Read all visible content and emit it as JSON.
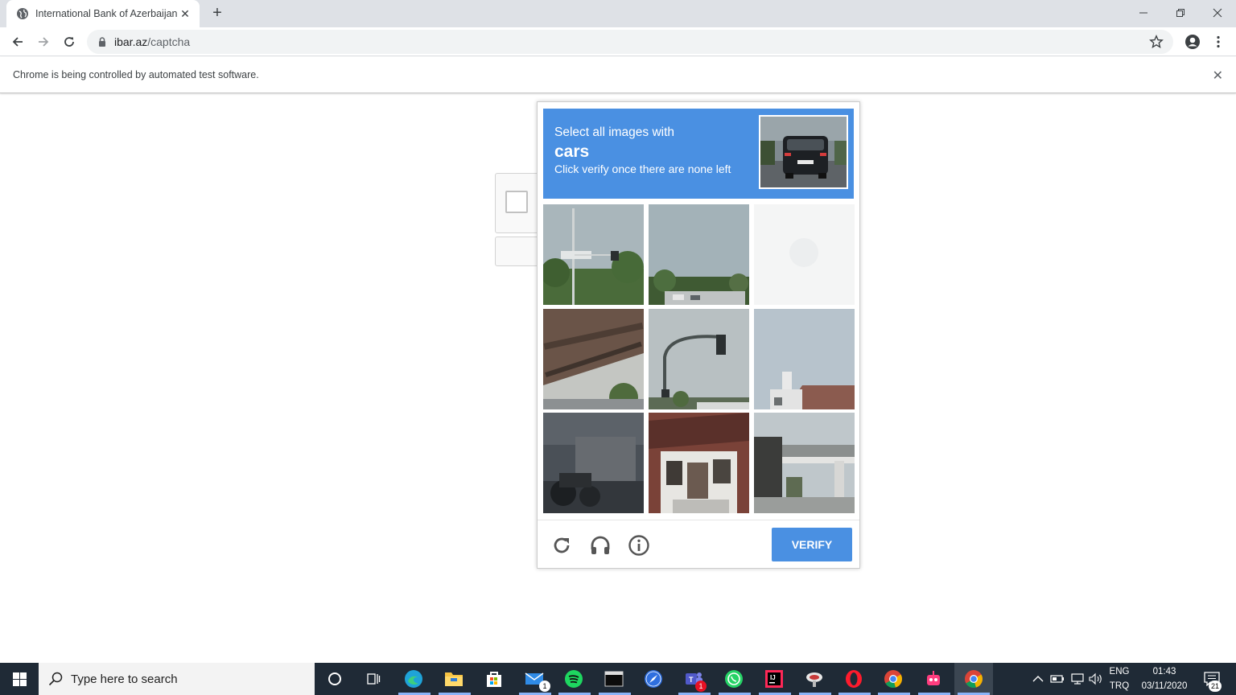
{
  "browser": {
    "tab_title": "International Bank of Azerbaijan",
    "url_host": "ibar.az",
    "url_path": "/captcha",
    "infobar_message": "Chrome is being controlled by automated test software."
  },
  "captcha": {
    "instruction_line1": "Select all images with",
    "keyword": "cars",
    "instruction_line3": "Click verify once there are none left",
    "verify_label": "VERIFY",
    "tiles": [
      {
        "name": "tile-1",
        "depicts": "street sign pole and trees"
      },
      {
        "name": "tile-2",
        "depicts": "sky with trees and parking lot"
      },
      {
        "name": "tile-3",
        "depicts": "blank faded tile"
      },
      {
        "name": "tile-4",
        "depicts": "bridge structure underside"
      },
      {
        "name": "tile-5",
        "depicts": "traffic light pole"
      },
      {
        "name": "tile-6",
        "depicts": "house rooftop and chimney"
      },
      {
        "name": "tile-7",
        "depicts": "dark vehicle and motorcycle"
      },
      {
        "name": "tile-8",
        "depicts": "brick house facade"
      },
      {
        "name": "tile-9",
        "depicts": "overpass bridge"
      }
    ]
  },
  "taskbar": {
    "search_placeholder": "Type here to search",
    "lang_top": "ENG",
    "lang_bottom": "TRQ",
    "time": "01:43",
    "date": "03/11/2020",
    "notification_count": "21",
    "mail_badge": "1",
    "teams_badge": "1"
  },
  "colors": {
    "captcha_blue": "#4a90e2",
    "taskbar_bg": "#1f2a36"
  }
}
